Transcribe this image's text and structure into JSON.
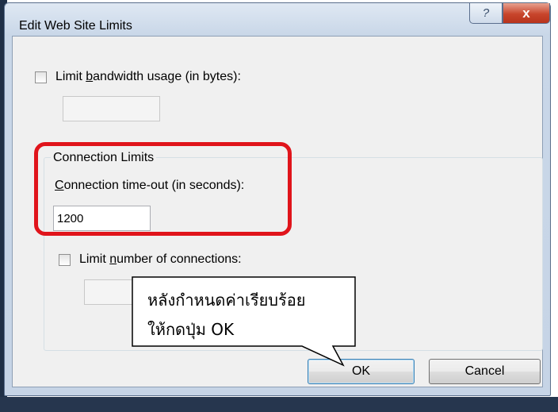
{
  "window": {
    "title": "Edit Web Site Limits",
    "help_glyph": "?",
    "close_glyph": "x"
  },
  "bandwidth": {
    "label_before": "Limit ",
    "label_mnemonic": "b",
    "label_after": "andwidth usage (in bytes):",
    "checked": false,
    "value": ""
  },
  "connection_limits": {
    "group_title": "Connection Limits",
    "timeout_label_mnemonic": "C",
    "timeout_label_after": "onnection time-out (in seconds):",
    "timeout_value": "1200",
    "limit_before": "Limit ",
    "limit_mnemonic": "n",
    "limit_after": "umber of connections:",
    "limit_checked": false,
    "limit_value": ""
  },
  "buttons": {
    "ok": "OK",
    "cancel": "Cancel"
  },
  "callout": {
    "line1": "หลังกำหนดค่าเรียบร้อย",
    "line2": "ให้กดปุ่ม OK"
  },
  "colors": {
    "highlight": "#e0141b",
    "ok_border": "#3c7fb1"
  }
}
